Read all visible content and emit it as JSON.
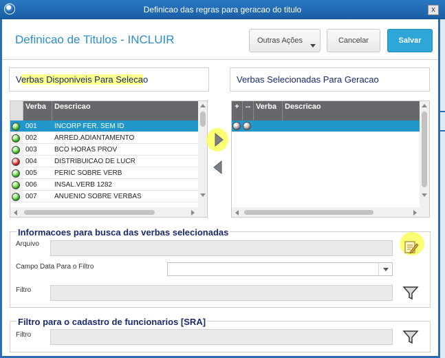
{
  "window": {
    "title": "Definicao das regras para geracao do titulo",
    "close_label": "x"
  },
  "header": {
    "title": "Definicao de Titulos - INCLUIR",
    "buttons": {
      "other_actions": "Outras Ações",
      "cancel": "Cancelar",
      "save": "Salvar"
    }
  },
  "available": {
    "title": "Verbas Disponiveis Para Selecao",
    "columns": {
      "verba": "Verba",
      "descricao": "Descricao"
    },
    "rows": [
      {
        "status": "green",
        "verba": "001",
        "descricao": "INCORP FER. SEM ID",
        "selected": true
      },
      {
        "status": "green",
        "verba": "002",
        "descricao": "ARRED.ADIANTAMENTO",
        "selected": false
      },
      {
        "status": "green",
        "verba": "003",
        "descricao": "BCO HORAS PROV",
        "selected": false
      },
      {
        "status": "red",
        "verba": "004",
        "descricao": "DISTRIBUICAO DE LUCR",
        "selected": false
      },
      {
        "status": "green",
        "verba": "005",
        "descricao": "PERIC SOBRE VERB",
        "selected": false
      },
      {
        "status": "green",
        "verba": "006",
        "descricao": "INSAL.VERB 1282",
        "selected": false
      },
      {
        "status": "green",
        "verba": "007",
        "descricao": "ANUENIO SOBRE VERBAS",
        "selected": false
      }
    ]
  },
  "selected": {
    "title": "Verbas Selecionadas Para Geracao",
    "columns": {
      "plus": "+",
      "minus": "--",
      "verba": "Verba",
      "descricao": "Descricao"
    }
  },
  "transfer": {
    "add_icon": "arrow-right-icon",
    "remove_icon": "arrow-left-icon"
  },
  "search_info": {
    "title": "Informacoes para busca das verbas selecionadas",
    "arquivo_label": "Arquivo",
    "arquivo_value": "",
    "campo_data_label": "Campo Data Para o Filtro",
    "campo_data_value": "",
    "filtro_label": "Filtro",
    "filtro_value": ""
  },
  "sra_filter": {
    "title": "Filtro para o cadastro de funcionarios [SRA]",
    "filtro_label": "Filtro",
    "filtro_value": ""
  },
  "colors": {
    "accent": "#2ea7d8",
    "title_blue": "#2a8fc9",
    "selected_row": "#2198c9",
    "highlight": "#fbff8a"
  }
}
